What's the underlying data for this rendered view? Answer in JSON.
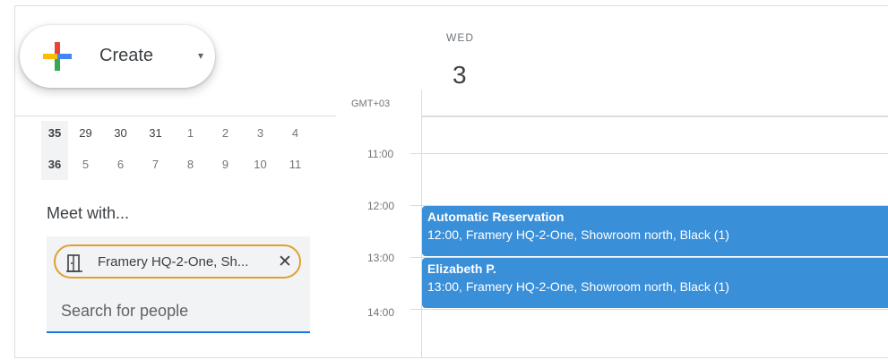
{
  "create_button": {
    "label": "Create",
    "caret": "▾"
  },
  "mini_calendar": {
    "rows": [
      {
        "week": "35",
        "days": [
          "29",
          "30",
          "31",
          "1",
          "2",
          "3",
          "4"
        ]
      },
      {
        "week": "36",
        "days": [
          "5",
          "6",
          "7",
          "8",
          "9",
          "10",
          "11"
        ]
      }
    ]
  },
  "meet_with": {
    "title": "Meet with...",
    "chip_label": "Framery HQ-2-One, Sh...",
    "chip_close": "✕",
    "search_placeholder": "Search for people"
  },
  "day_header": {
    "day_name": "WED",
    "day_number": "3",
    "timezone": "GMT+03"
  },
  "time_labels": [
    "11:00",
    "12:00",
    "13:00",
    "14:00"
  ],
  "events": [
    {
      "title": "Automatic Reservation",
      "details": "12:00, Framery HQ-2-One, Showroom north, Black (1)"
    },
    {
      "title": "Elizabeth P.",
      "details": "13:00, Framery HQ-2-One, Showroom north, Black (1)"
    }
  ],
  "colors": {
    "event": "#3a8fd9",
    "accent": "#1a73e8",
    "chip_border": "#e0a030"
  }
}
